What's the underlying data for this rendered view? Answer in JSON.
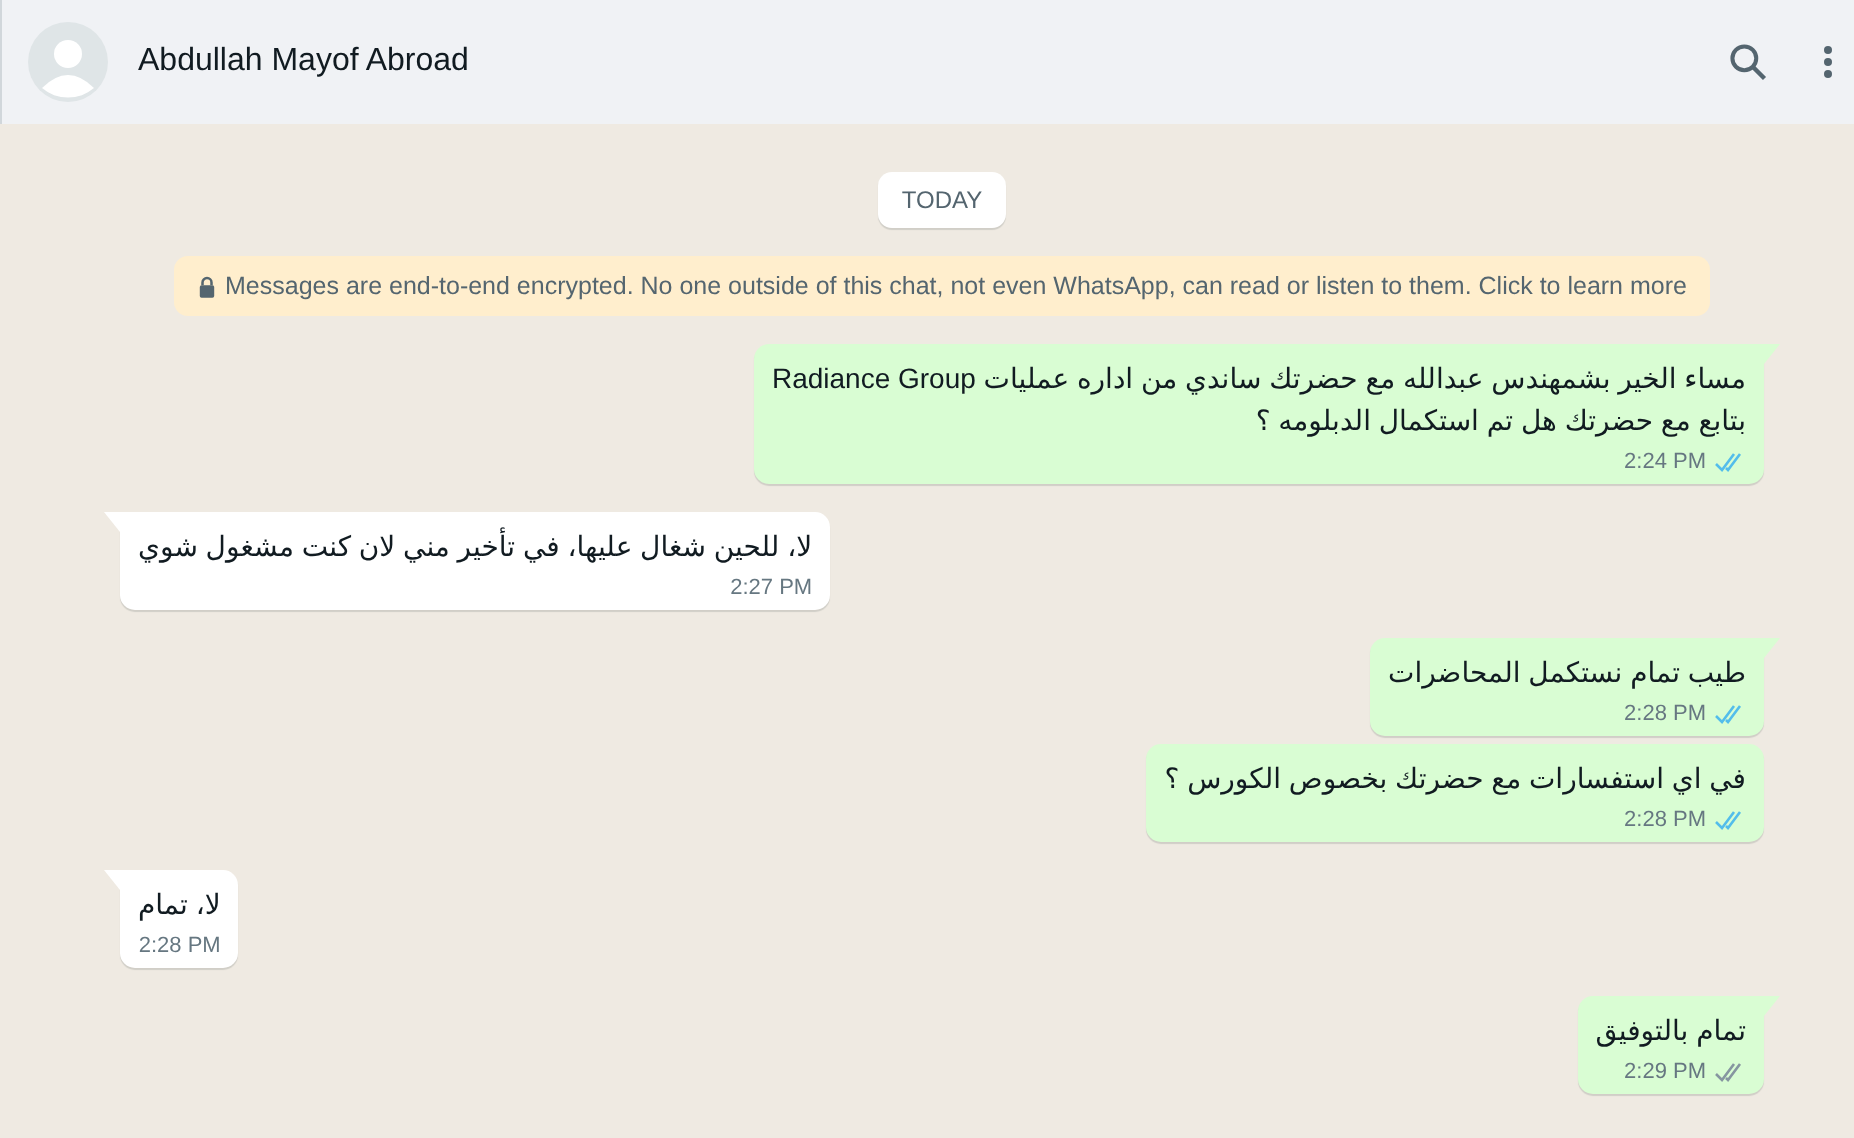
{
  "header": {
    "name": "Abdullah Mayof Abroad"
  },
  "date_chip": "TODAY",
  "encryption_notice": "Messages are end-to-end encrypted. No one outside of this chat, not even WhatsApp, can read or listen to them. Click to learn more",
  "messages": [
    {
      "kind": "outgoing",
      "tail": true,
      "text": "مساء الخير بشمهندس عبدالله مع حضرتك ساندي من اداره عمليات Radiance Group\nبتابع مع حضرتك هل تم استكمال الدبلومه ؟",
      "time": "2:24 PM",
      "read": true
    },
    {
      "kind": "incoming",
      "tail": true,
      "text": "لا، للحين شغال عليها، في تأخير مني لان كنت مشغول شوي",
      "time": "2:27 PM"
    },
    {
      "kind": "outgoing",
      "tail": true,
      "text": "طيب تمام نستكمل المحاضرات",
      "time": "2:28 PM",
      "read": true
    },
    {
      "kind": "outgoing",
      "tail": false,
      "text": "في اي استفسارات مع حضرتك بخصوص الكورس ؟",
      "time": "2:28 PM",
      "read": true
    },
    {
      "kind": "incoming",
      "tail": true,
      "text": "لا، تمام",
      "time": "2:28 PM"
    },
    {
      "kind": "outgoing",
      "tail": true,
      "text": "تمام بالتوفيق",
      "time": "2:29 PM",
      "read": false
    }
  ]
}
